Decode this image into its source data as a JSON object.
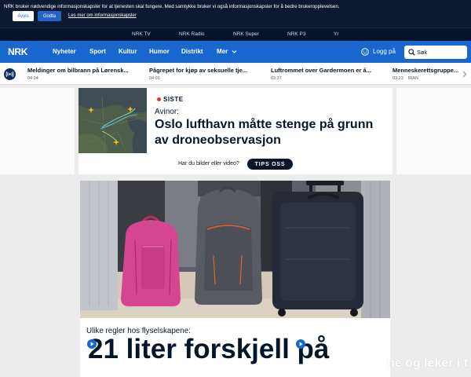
{
  "colors": {
    "banner_bg": "#0b1a31",
    "service_nav_bg": "#061429",
    "brand_blue": "#1767ce",
    "ink": "#061629",
    "siste_red": "#e3342b",
    "page_bg": "#ececec"
  },
  "cookie_banner": {
    "message": "NRK bruker nødvendige informasjonskapsler for at tjenesten skal fungere. Med samtykke bruker vi også informasjonskapsler for å bedre brukeropplevelsen.",
    "reject_label": "Avvis",
    "accept_label": "Godta",
    "more_link": "Les mer om informasjonskapsler"
  },
  "service_nav": [
    "NRK TV",
    "NRK Radio",
    "NRK Super",
    "NRK P3",
    "Yr"
  ],
  "main_nav": {
    "logo": "NRK",
    "items": [
      "Nyheter",
      "Sport",
      "Kultur",
      "Humor",
      "Distrikt",
      "Mer"
    ],
    "login_label": "Logg på",
    "login_icon": "user-icon",
    "search_label": "Søk",
    "search_icon": "search-icon"
  },
  "ticker": {
    "radio_icon": "radio-icon",
    "items": [
      {
        "title": "Meldinger om bilbrann på Lørensk...",
        "time": "04:04"
      },
      {
        "title": "Pågrepet for kjøp av seksuelle tje...",
        "time": "04:01"
      },
      {
        "title": "Luftrommet over Gardermoen er å...",
        "time": "03:37"
      },
      {
        "title": "Menneskerettsgruppe...",
        "time": "03:23",
        "tag": "IRAN"
      }
    ]
  },
  "top_story": {
    "label": "SISTE",
    "kicker": "Avinor:",
    "headline": "Oslo lufthavn måtte stenge på grunn av droneobservasjon",
    "tip_prompt": "Har du bilder eller video?",
    "tip_button": "TIPS OSS"
  },
  "second_story": {
    "kicker": "Ulike regler hos flyselskapene:",
    "headline": "21 liter forskjell på"
  },
  "side_teaser": {
    "text": "ne og leker i t"
  }
}
